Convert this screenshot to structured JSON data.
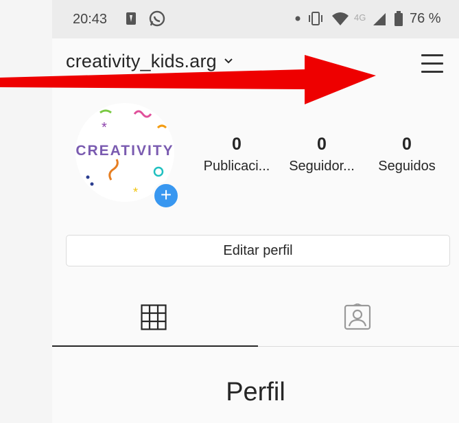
{
  "status_bar": {
    "time": "20:43",
    "battery_percent": "76 %",
    "network": "4G",
    "icons": [
      "notification-icon",
      "whatsapp-icon",
      "dot-icon",
      "vibrate-icon",
      "wifi-icon",
      "signal-icon",
      "battery-icon"
    ]
  },
  "header": {
    "username": "creativity_kids.arg",
    "menu_icon": "hamburger-menu-icon"
  },
  "profile": {
    "avatar_text": "CREATIVITY",
    "add_icon": "+",
    "stats": [
      {
        "value": "0",
        "label": "Publicaci..."
      },
      {
        "value": "0",
        "label": "Seguidor..."
      },
      {
        "value": "0",
        "label": "Seguidos"
      }
    ],
    "edit_button": "Editar perfil"
  },
  "tabs": {
    "grid_icon": "grid-icon",
    "tagged_icon": "tagged-person-icon",
    "active": "grid"
  },
  "content": {
    "title": "Perfil"
  },
  "colors": {
    "accent": "#3897f0",
    "arrow": "#ee0000",
    "status_bar_bg": "#ececec"
  }
}
